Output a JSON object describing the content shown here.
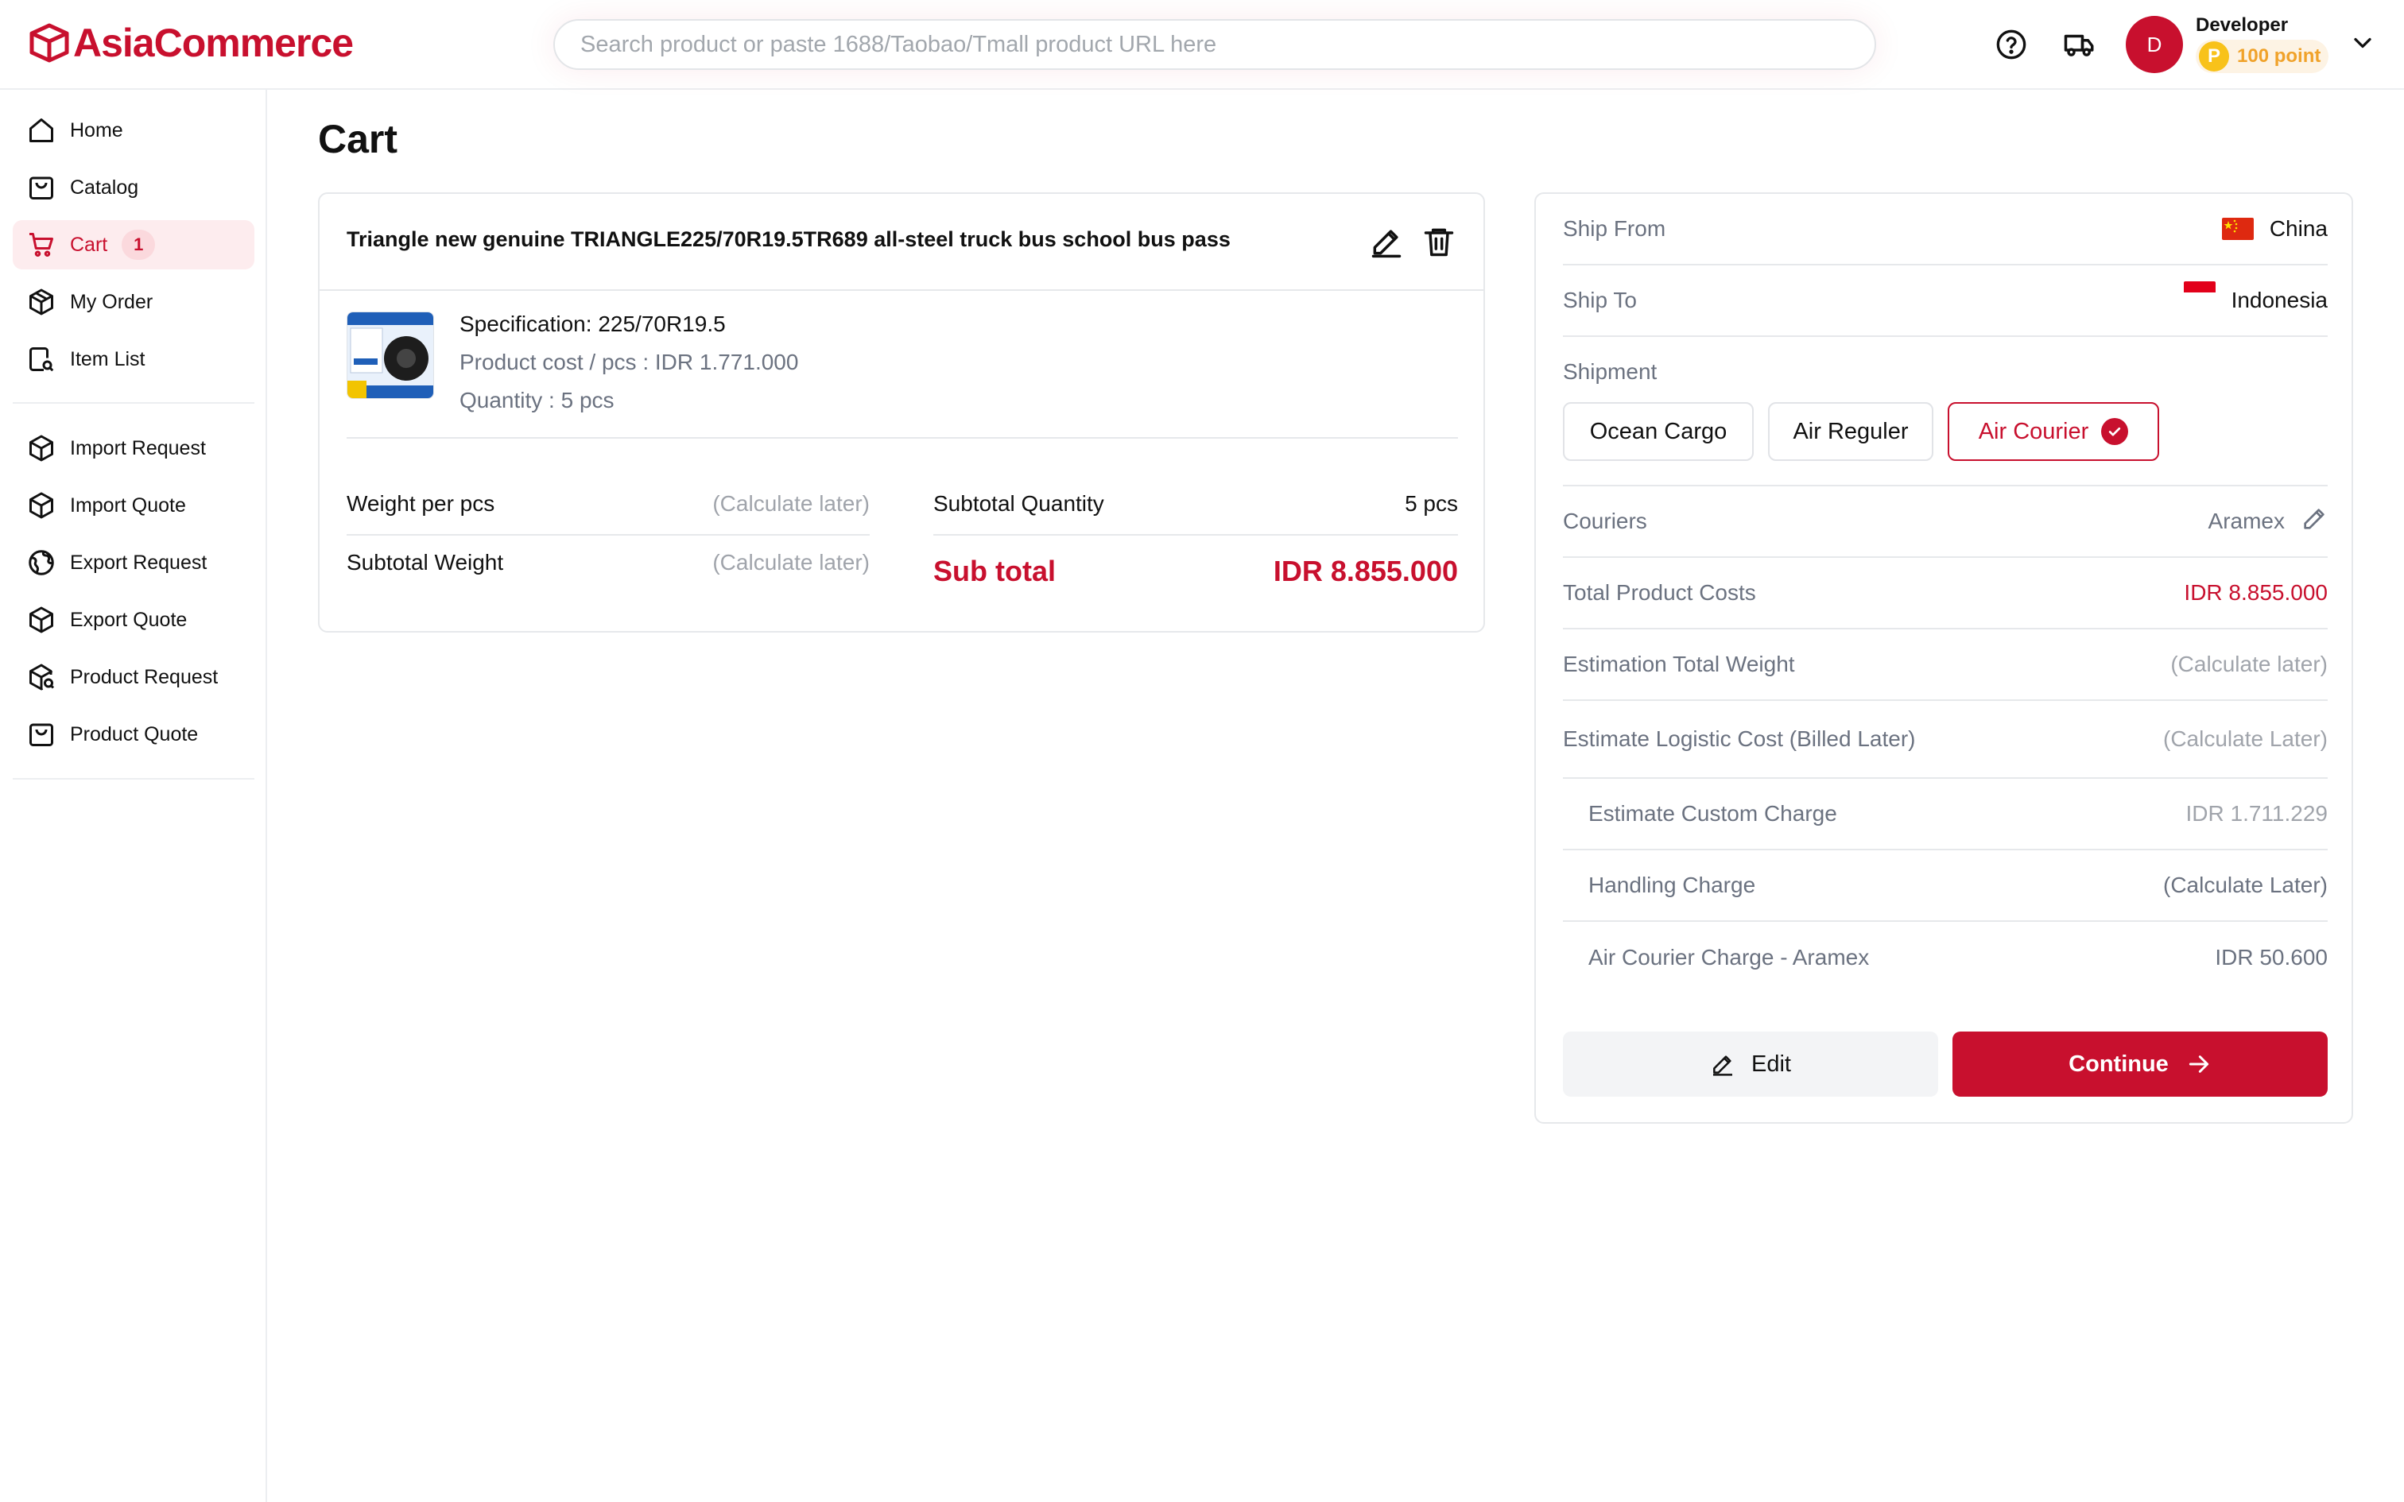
{
  "header": {
    "logo_text": "AsiaCommerce",
    "search_placeholder": "Search product or paste 1688/Taobao/Tmall product URL here",
    "user": {
      "initial": "D",
      "name": "Developer",
      "points_label": "100 point",
      "coin_letter": "P"
    },
    "icons": [
      "help-circle-icon",
      "truck-icon",
      "chevron-down-icon"
    ]
  },
  "sidebar": {
    "items": [
      {
        "label": "Home",
        "icon": "home-icon"
      },
      {
        "label": "Catalog",
        "icon": "bag-icon"
      },
      {
        "label": "Cart",
        "icon": "cart-icon",
        "badge": "1",
        "active": true
      },
      {
        "label": "My Order",
        "icon": "package-icon"
      },
      {
        "label": "Item List",
        "icon": "list-search-icon"
      }
    ],
    "items2": [
      {
        "label": "Import Request",
        "icon": "box-icon"
      },
      {
        "label": "Import Quote",
        "icon": "box-icon"
      },
      {
        "label": "Export Request",
        "icon": "globe-icon"
      },
      {
        "label": "Export Quote",
        "icon": "box-icon"
      },
      {
        "label": "Product Request",
        "icon": "box-search-icon"
      },
      {
        "label": "Product Quote",
        "icon": "bag-icon"
      }
    ]
  },
  "main": {
    "title": "Cart",
    "item": {
      "title": "Triangle new genuine TRIANGLE225/70R19.5TR689 all-steel truck bus school bus pass",
      "specification": "Specification: 225/70R19.5",
      "product_cost": "Product cost / pcs : IDR 1.771.000",
      "quantity": "Quantity : 5 pcs",
      "weight_per_pcs_label": "Weight per pcs",
      "weight_per_pcs_value": "(Calculate later)",
      "subtotal_weight_label": "Subtotal Weight",
      "subtotal_weight_value": "(Calculate later)",
      "subtotal_qty_label": "Subtotal Quantity",
      "subtotal_qty_value": "5 pcs",
      "subtotal_label": "Sub total",
      "subtotal_value": "IDR 8.855.000"
    }
  },
  "summary": {
    "ship_from_label": "Ship From",
    "ship_from_value": "China",
    "ship_to_label": "Ship To",
    "ship_to_value": "Indonesia",
    "shipment_label": "Shipment",
    "shipment_options": [
      "Ocean Cargo",
      "Air Reguler",
      "Air Courier"
    ],
    "shipment_selected": "Air Courier",
    "couriers_label": "Couriers",
    "couriers_value": "Aramex",
    "total_product_costs_label": "Total Product Costs",
    "total_product_costs_value": "IDR 8.855.000",
    "est_total_weight_label": "Estimation Total Weight",
    "est_total_weight_value": "(Calculate later)",
    "est_logistic_label": "Estimate Logistic Cost (Billed Later)",
    "est_logistic_value": "(Calculate Later)",
    "custom_charge_label": "Estimate Custom Charge",
    "custom_charge_value": "IDR 1.711.229",
    "handling_label": "Handling Charge",
    "handling_value": "(Calculate Later)",
    "air_courier_label": "Air Courier Charge - Aramex",
    "air_courier_value": "IDR 50.600",
    "edit_button": "Edit",
    "continue_button": "Continue"
  },
  "colors": {
    "brand": "#c8102e",
    "muted": "#6b7280",
    "light": "#a0a4ab"
  }
}
